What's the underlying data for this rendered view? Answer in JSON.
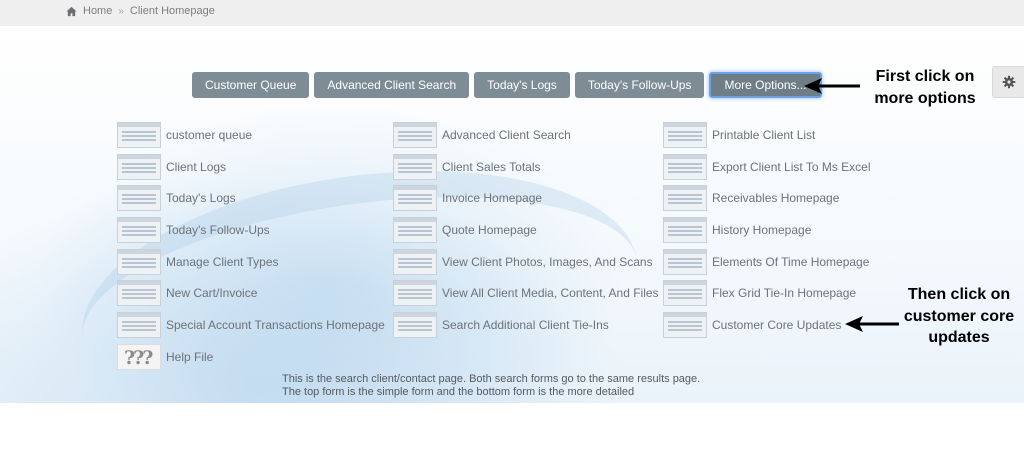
{
  "breadcrumb": {
    "home": "Home",
    "separator": "»",
    "current": "Client Homepage"
  },
  "buttons": [
    "Customer Queue",
    "Advanced Client Search",
    "Today's Logs",
    "Today's Follow-Ups",
    "More Options..."
  ],
  "columns": [
    [
      "customer queue",
      "Client Logs",
      "Today's Logs",
      "Today's Follow-Ups",
      "Manage Client Types",
      "New Cart/Invoice",
      "Special Account Transactions Homepage",
      "Help File"
    ],
    [
      "Advanced Client Search",
      "Client Sales Totals",
      "Invoice Homepage",
      "Quote Homepage",
      "View Client Photos, Images, And Scans",
      "View All Client Media, Content, And Files",
      "Search Additional Client Tie-Ins"
    ],
    [
      "Printable Client List",
      "Export Client List To Ms Excel",
      "Receivables Homepage",
      "History Homepage",
      "Elements Of Time Homepage",
      "Flex Grid Tie-In Homepage",
      "Customer Core Updates"
    ]
  ],
  "help_thumb_text": "???",
  "description": "This is the search client/contact page. Both search forms go to the same results page. The top form is the simple form and the bottom form is the more detailed",
  "annotations": {
    "first": "First click on more options",
    "then": "Then click on customer core updates"
  },
  "icons": {
    "home": "home-icon",
    "gear": "gear-icon",
    "arrow": "arrow-left-icon"
  },
  "colors": {
    "button": "#7e8c95",
    "active_border": "#6aa2e8"
  }
}
